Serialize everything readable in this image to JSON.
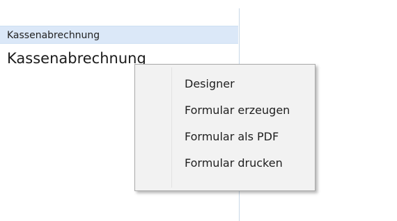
{
  "list": {
    "selected_item": "Kassenabrechnung",
    "large_item": "Kassenabrechnung"
  },
  "context_menu": {
    "items": [
      {
        "label": "Designer"
      },
      {
        "label": "Formular erzeugen"
      },
      {
        "label": "Formular als PDF"
      },
      {
        "label": "Formular drucken"
      }
    ]
  },
  "colors": {
    "selection_background": "#dbe8f8",
    "menu_background": "#f2f2f2",
    "menu_border": "#a9a9a9",
    "divider": "#c9d7e6"
  }
}
